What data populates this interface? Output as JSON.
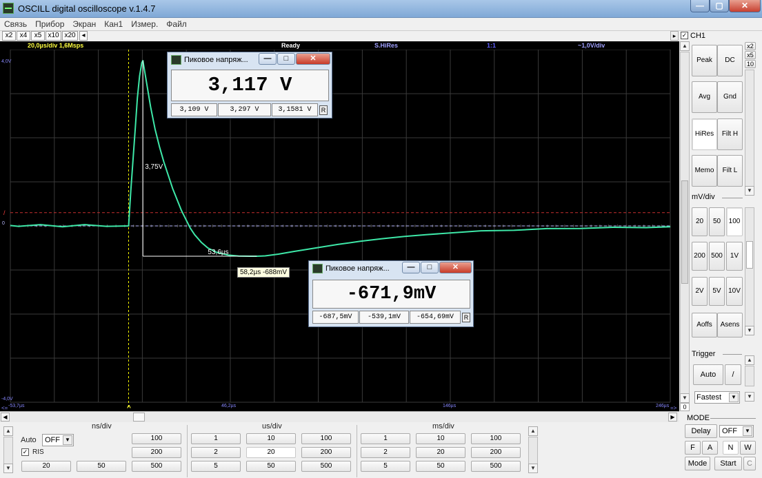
{
  "window": {
    "title": "OSCILL digital oscilloscope  v.1.4.7"
  },
  "menu": [
    "Связь",
    "Прибор",
    "Экран",
    "Кан1",
    "Измер.",
    "Файл"
  ],
  "zoom_buttons": [
    "x2",
    "x4",
    "x5",
    "x10",
    "x20"
  ],
  "scope": {
    "timebase": "20,0µs/div  1,6Msps",
    "status": "Ready",
    "mode": "S.HiRes",
    "ratio": "1:1",
    "volts_div": "~1,0V/div",
    "top_label": "4,0V",
    "bottom_label": "-4,0V",
    "zero_label": "0",
    "trigger_marker": "/",
    "trigger_arrow": "^",
    "time_labels": [
      "-53,7µs",
      "46,2µs",
      "146µs",
      "246µs"
    ],
    "scroll_left": "<=",
    "scroll_right": "=>",
    "annotation_amplitude": "3,75V",
    "annotation_time": "53,6µs",
    "tooltip": "58,2µs  -688mV",
    "colors": {
      "trace": "#3ee8a8",
      "grid": "#3a3a3a",
      "trigger_line": "#ffff00",
      "ref_line": "#c83030",
      "zero_line": "#b8b8ff",
      "header_yellow": "#ffff40",
      "header_blue": "#8080ff"
    }
  },
  "peak_window_1": {
    "title": "Пиковое напряж...",
    "value": "3,117  V",
    "sub": [
      "3,109 V",
      "3,297 V",
      "3,1581 V"
    ],
    "r_label": "R"
  },
  "peak_window_2": {
    "title": "Пиковое напряж...",
    "value": "-671,9mV",
    "sub": [
      "-687,5mV",
      "-539,1mV",
      "-654,69mV"
    ],
    "r_label": "R"
  },
  "channel": {
    "label": "CH1",
    "checked": true,
    "gain_buttons": [
      "x2",
      "x5",
      "10"
    ],
    "buttons": [
      "Peak",
      "DC",
      "Avg",
      "Gnd",
      "HiRes",
      "Filt H",
      "Memo",
      "Filt L"
    ],
    "mv_div_label": "mV/div",
    "mv_div_values": [
      "20",
      "50",
      "100",
      "200",
      "500",
      "1V",
      "2V",
      "5V",
      "10V"
    ],
    "offset_buttons": [
      "Aoffs",
      "Asens"
    ]
  },
  "trigger": {
    "label": "Trigger",
    "auto_label": "Auto",
    "edge_label": "/",
    "speed": "Fastest"
  },
  "bottom": {
    "ns_div_label": "ns/div",
    "us_div_label": "us/div",
    "ms_div_label": "ms/div",
    "auto_label": "Auto",
    "auto_value": "OFF",
    "ris_label": "RIS",
    "ris_checked": true,
    "ns_values": [
      "100",
      "200",
      "500",
      "20",
      "50"
    ],
    "us_values": [
      "1",
      "10",
      "100",
      "2",
      "20",
      "200",
      "5",
      "50",
      "500"
    ],
    "ms_values": [
      "1",
      "10",
      "100",
      "2",
      "20",
      "200",
      "5",
      "50",
      "500"
    ],
    "scroll_zero": "0"
  },
  "mode_panel": {
    "label": "MODE",
    "delay_label": "Delay",
    "delay_value": "OFF",
    "buttons_row1": [
      "F",
      "A",
      "N",
      "W"
    ],
    "mode_label": "Mode",
    "start_label": "Start",
    "c_label": "C"
  },
  "chart_data": {
    "type": "line",
    "xlabel": "",
    "ylabel": "",
    "xlim": [
      -53.7,
      246
    ],
    "ylim": [
      -4.0,
      4.0
    ],
    "grid": true,
    "series": [
      {
        "x": [
          -53.7,
          -50,
          -40,
          -30,
          -20,
          -10,
          0,
          1,
          2,
          3,
          4,
          5,
          6,
          6.5,
          7,
          8,
          10,
          12,
          14,
          16,
          18,
          20,
          22,
          24,
          26,
          28,
          30,
          33,
          36,
          40,
          45,
          50,
          55,
          58.2,
          62,
          68,
          75,
          85,
          95,
          105,
          115,
          125,
          135,
          146,
          160,
          175,
          190,
          205,
          220,
          235,
          246
        ],
        "y": [
          0.0,
          0.0,
          0.02,
          -0.01,
          0.02,
          0.0,
          0.0,
          0.8,
          1.5,
          2.2,
          2.9,
          3.4,
          3.7,
          3.75,
          3.6,
          3.3,
          2.7,
          2.2,
          1.8,
          1.45,
          1.15,
          0.85,
          0.6,
          0.35,
          0.15,
          -0.05,
          -0.2,
          -0.37,
          -0.5,
          -0.6,
          -0.66,
          -0.685,
          -0.688,
          -0.688,
          -0.68,
          -0.64,
          -0.58,
          -0.5,
          -0.42,
          -0.35,
          -0.29,
          -0.24,
          -0.2,
          -0.16,
          -0.12,
          -0.09,
          -0.07,
          -0.05,
          -0.04,
          -0.03,
          -0.03
        ]
      }
    ]
  }
}
